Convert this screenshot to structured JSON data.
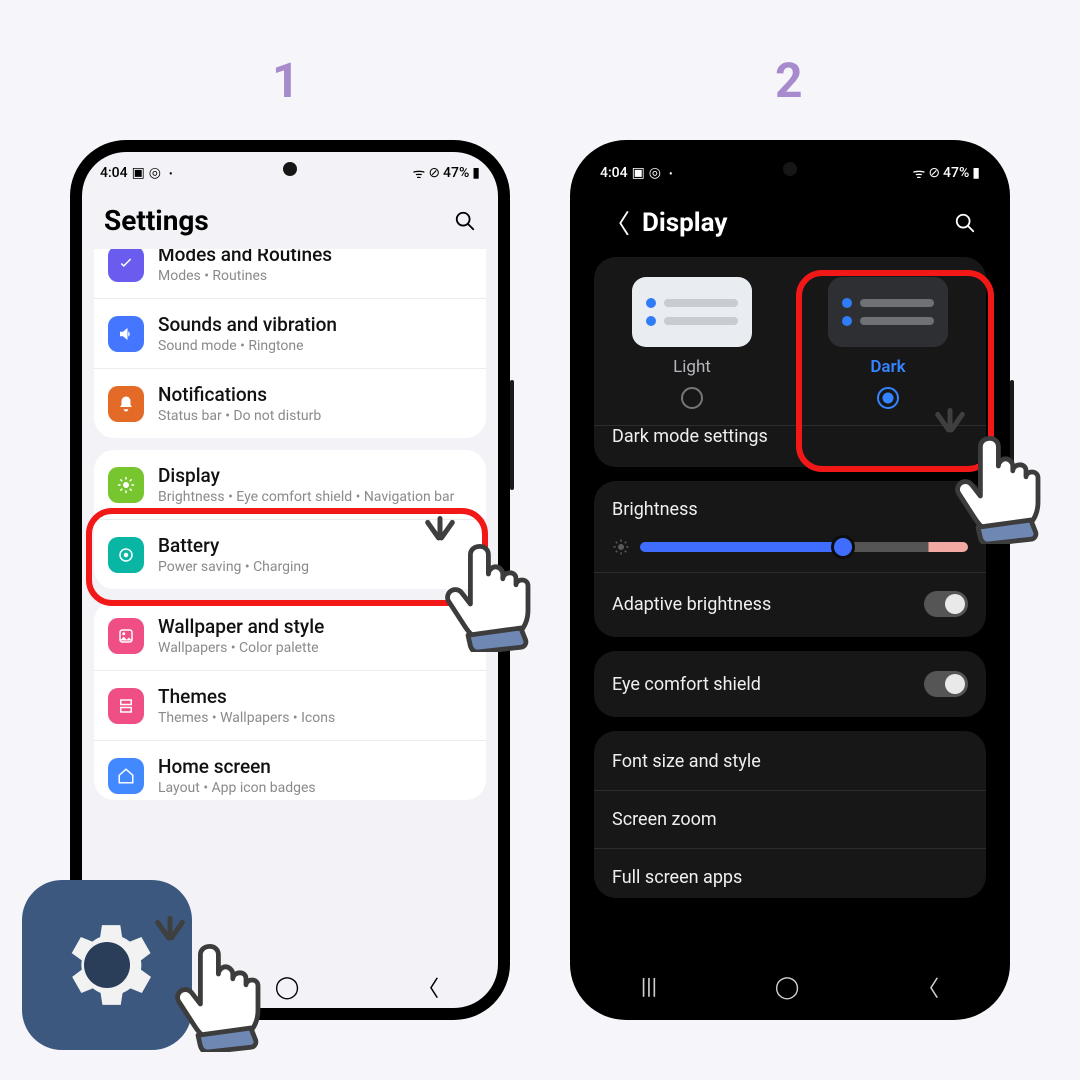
{
  "steps": {
    "one": "1",
    "two": "2"
  },
  "status": {
    "time": "4:04",
    "battery_pct": "47%"
  },
  "settings": {
    "title": "Settings",
    "rows": [
      {
        "title": "Modes and Routines",
        "sub": "Modes  •  Routines",
        "color": "ic-purple",
        "glyph": "check"
      },
      {
        "title": "Sounds and vibration",
        "sub": "Sound mode  •  Ringtone",
        "color": "ic-blue",
        "glyph": "sound"
      },
      {
        "title": "Notifications",
        "sub": "Status bar  •  Do not disturb",
        "color": "ic-orange",
        "glyph": "bell"
      },
      {
        "title": "Display",
        "sub": "Brightness  •  Eye comfort shield  •  Navigation bar",
        "color": "ic-green",
        "glyph": "sun"
      },
      {
        "title": "Battery",
        "sub": "Power saving  •  Charging",
        "color": "ic-teal",
        "glyph": "batt"
      },
      {
        "title": "Wallpaper and style",
        "sub": "Wallpapers  •  Color palette",
        "color": "ic-pink",
        "glyph": "wall"
      },
      {
        "title": "Themes",
        "sub": "Themes  •  Wallpapers  •  Icons",
        "color": "ic-pink2",
        "glyph": "theme"
      },
      {
        "title": "Home screen",
        "sub": "Layout  •  App icon badges",
        "color": "ic-blue2",
        "glyph": "home"
      }
    ]
  },
  "display": {
    "title": "Display",
    "light_label": "Light",
    "dark_label": "Dark",
    "dark_mode_settings": "Dark mode settings",
    "brightness": "Brightness",
    "adaptive": "Adaptive brightness",
    "eye": "Eye comfort shield",
    "font": "Font size and style",
    "zoom": "Screen zoom",
    "full": "Full screen apps"
  }
}
